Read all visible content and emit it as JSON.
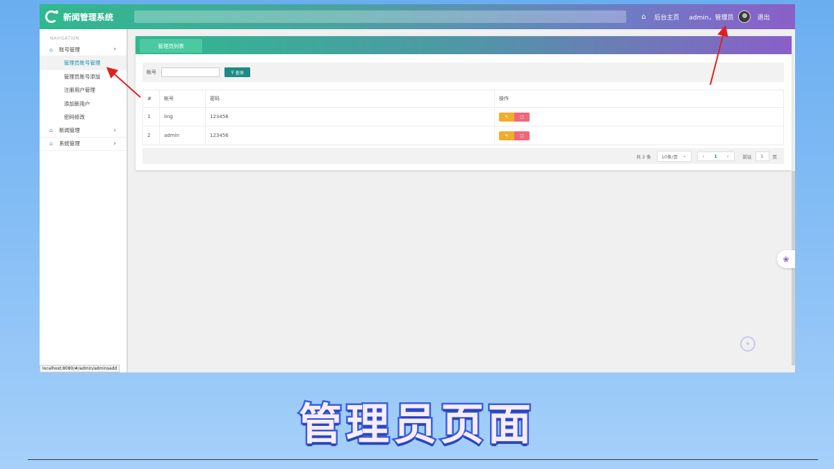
{
  "app": {
    "title": "新闻管理系统"
  },
  "header": {
    "home_label": "后台主页",
    "user_label": "admin，管理员",
    "logout_label": "退出"
  },
  "sidebar": {
    "nav_title": "NAVIGATION",
    "groups": [
      {
        "label": "账号管理",
        "items": [
          {
            "label": "管理员账号管理"
          },
          {
            "label": "管理员账号添加"
          },
          {
            "label": "注册用户管理"
          },
          {
            "label": "添加新用户"
          },
          {
            "label": "密码修改"
          }
        ]
      },
      {
        "label": "新闻管理"
      },
      {
        "label": "系统管理"
      }
    ]
  },
  "main": {
    "tab_label": "管理员列表",
    "search": {
      "label": "帐号",
      "value": "",
      "button": "查询"
    },
    "table": {
      "headers": [
        "#",
        "帐号",
        "密码",
        "操作"
      ],
      "rows": [
        {
          "index": "1",
          "account": "ling",
          "password": "123456"
        },
        {
          "index": "2",
          "account": "admin",
          "password": "123456"
        }
      ]
    },
    "pager": {
      "total": "共 2 条",
      "page_size": "10条/页",
      "current": "1",
      "goto_label": "前往",
      "goto_value": "1",
      "page_unit": "页"
    }
  },
  "status_url": "localhost:8080/#/admin/adminsadd",
  "caption": "管理员页面",
  "colors": {
    "header_start": "#2fb98e",
    "header_end": "#8a5fc8",
    "search_button": "#1e8a86",
    "edit_button": "#f0ad2a",
    "delete_button": "#f0677a",
    "annotation_arrow": "#e02020",
    "caption_stroke": "#3b5fe0"
  }
}
